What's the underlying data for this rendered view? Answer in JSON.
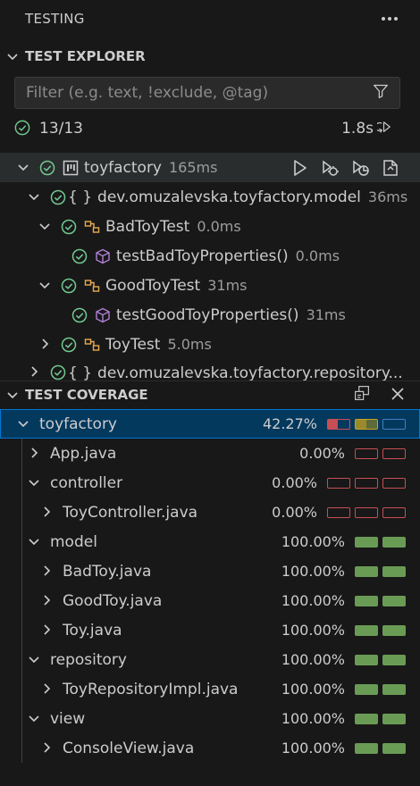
{
  "panel": {
    "title": "TESTING"
  },
  "explorer": {
    "title": "TEST EXPLORER",
    "filter_placeholder": "Filter (e.g. text, !exclude, @tag)",
    "summary_count": "13/13",
    "summary_duration": "1.8s",
    "tree": [
      {
        "label": "toyfactory",
        "duration": "165ms"
      },
      {
        "label": "dev.omuzalevska.toyfactory.model",
        "duration": "36ms"
      },
      {
        "label": "BadToyTest",
        "duration": "0.0ms"
      },
      {
        "label": "testBadToyProperties()",
        "duration": "0.0ms"
      },
      {
        "label": "GoodToyTest",
        "duration": "31ms"
      },
      {
        "label": "testGoodToyProperties()",
        "duration": "31ms"
      },
      {
        "label": "ToyTest",
        "duration": "5.0ms"
      },
      {
        "label": "dev.omuzalevska.toyfactory.repository...",
        "duration": ""
      }
    ]
  },
  "coverage": {
    "title": "TEST COVERAGE",
    "items": [
      {
        "label": "toyfactory",
        "pct": "42.27%",
        "stmt": 0.45,
        "branch": 0.5,
        "func": 0.0
      },
      {
        "label": "App.java",
        "pct": "0.00%"
      },
      {
        "label": "controller",
        "pct": "0.00%"
      },
      {
        "label": "ToyController.java",
        "pct": "0.00%"
      },
      {
        "label": "model",
        "pct": "100.00%"
      },
      {
        "label": "BadToy.java",
        "pct": "100.00%"
      },
      {
        "label": "GoodToy.java",
        "pct": "100.00%"
      },
      {
        "label": "Toy.java",
        "pct": "100.00%"
      },
      {
        "label": "repository",
        "pct": "100.00%"
      },
      {
        "label": "ToyRepositoryImpl.java",
        "pct": "100.00%"
      },
      {
        "label": "view",
        "pct": "100.00%"
      },
      {
        "label": "ConsoleView.java",
        "pct": "100.00%"
      }
    ]
  },
  "colors": {
    "pass": "#73c991",
    "coverage_full": "#6a9b55",
    "coverage_none": "#c74e55",
    "class_icon": "#e8ab53",
    "method_icon": "#b180d7",
    "selection": "#04395e"
  }
}
